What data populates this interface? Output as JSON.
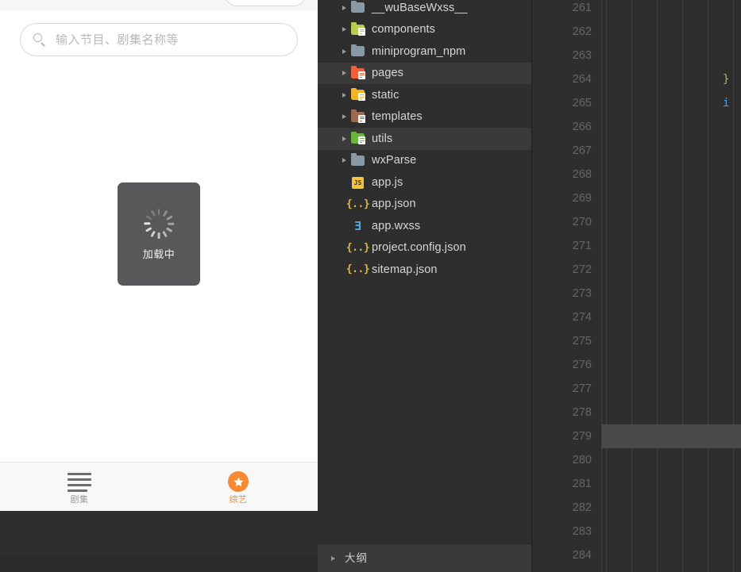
{
  "simulator": {
    "top_pill": {
      "label": ""
    },
    "search": {
      "icon": "search-icon",
      "placeholder": "输入节目、剧集名称等",
      "value": ""
    },
    "loading_toast": {
      "icon": "spinner-icon",
      "text": "加载中"
    },
    "tabbar": {
      "items": [
        {
          "icon": "list-icon",
          "label": "剧集",
          "active": false
        },
        {
          "icon": "star-icon",
          "label": "综艺",
          "active": true
        }
      ]
    },
    "colors": {
      "accent": "#f68a34",
      "toast_bg": "#58585a",
      "tab_inactive": "#9b9b9b"
    }
  },
  "filetree": {
    "items": [
      {
        "name": "__wuBaseWxss__",
        "type": "folder",
        "icon": "folder-plain-icon",
        "color": "#8a9aa5",
        "expandable": true,
        "selected": false
      },
      {
        "name": "components",
        "type": "folder",
        "icon": "folder-components-icon",
        "color": "#b8cc52",
        "expandable": true,
        "selected": false
      },
      {
        "name": "miniprogram_npm",
        "type": "folder",
        "icon": "folder-plain-icon",
        "color": "#8a9aa5",
        "expandable": true,
        "selected": false
      },
      {
        "name": "pages",
        "type": "folder",
        "icon": "folder-pages-icon",
        "color": "#f2603c",
        "expandable": true,
        "selected": true
      },
      {
        "name": "static",
        "type": "folder",
        "icon": "folder-static-icon",
        "color": "#f0b429",
        "expandable": true,
        "selected": false
      },
      {
        "name": "templates",
        "type": "folder",
        "icon": "folder-templates-icon",
        "color": "#9c6b4f",
        "expandable": true,
        "selected": false
      },
      {
        "name": "utils",
        "type": "folder",
        "icon": "folder-utils-icon",
        "color": "#6cb33f",
        "expandable": true,
        "selected": true
      },
      {
        "name": "wxParse",
        "type": "folder",
        "icon": "folder-plain-icon",
        "color": "#8a9aa5",
        "expandable": true,
        "selected": false
      },
      {
        "name": "app.js",
        "type": "file",
        "icon": "js-file-icon",
        "badge": "JS",
        "color": "#f5c33b",
        "expandable": false,
        "selected": false
      },
      {
        "name": "app.json",
        "type": "file",
        "icon": "json-file-icon",
        "badge": "{..}",
        "color": "#e2b93d",
        "expandable": false,
        "selected": false
      },
      {
        "name": "app.wxss",
        "type": "file",
        "icon": "css-file-icon",
        "badge": "Ǝ",
        "color": "#4aa8e0",
        "expandable": false,
        "selected": false
      },
      {
        "name": "project.config.json",
        "type": "file",
        "icon": "json-file-icon",
        "badge": "{..}",
        "color": "#e2b93d",
        "expandable": false,
        "selected": false
      },
      {
        "name": "sitemap.json",
        "type": "file",
        "icon": "json-file-icon",
        "badge": "{..}",
        "color": "#e2b93d",
        "expandable": false,
        "selected": false
      }
    ],
    "outline": {
      "label": "大纲",
      "expanded": false
    }
  },
  "editor": {
    "line_numbers": [
      261,
      262,
      263,
      264,
      265,
      266,
      267,
      268,
      269,
      270,
      271,
      272,
      273,
      274,
      275,
      276,
      277,
      278,
      279,
      280,
      281,
      282,
      283,
      284
    ],
    "active_line": 279,
    "code_tokens": [
      {
        "line": 264,
        "text": "}",
        "color": "#a9b86c"
      },
      {
        "line": 265,
        "text": "i",
        "color": "#5a9fd4"
      }
    ],
    "indent_guides": 6
  }
}
